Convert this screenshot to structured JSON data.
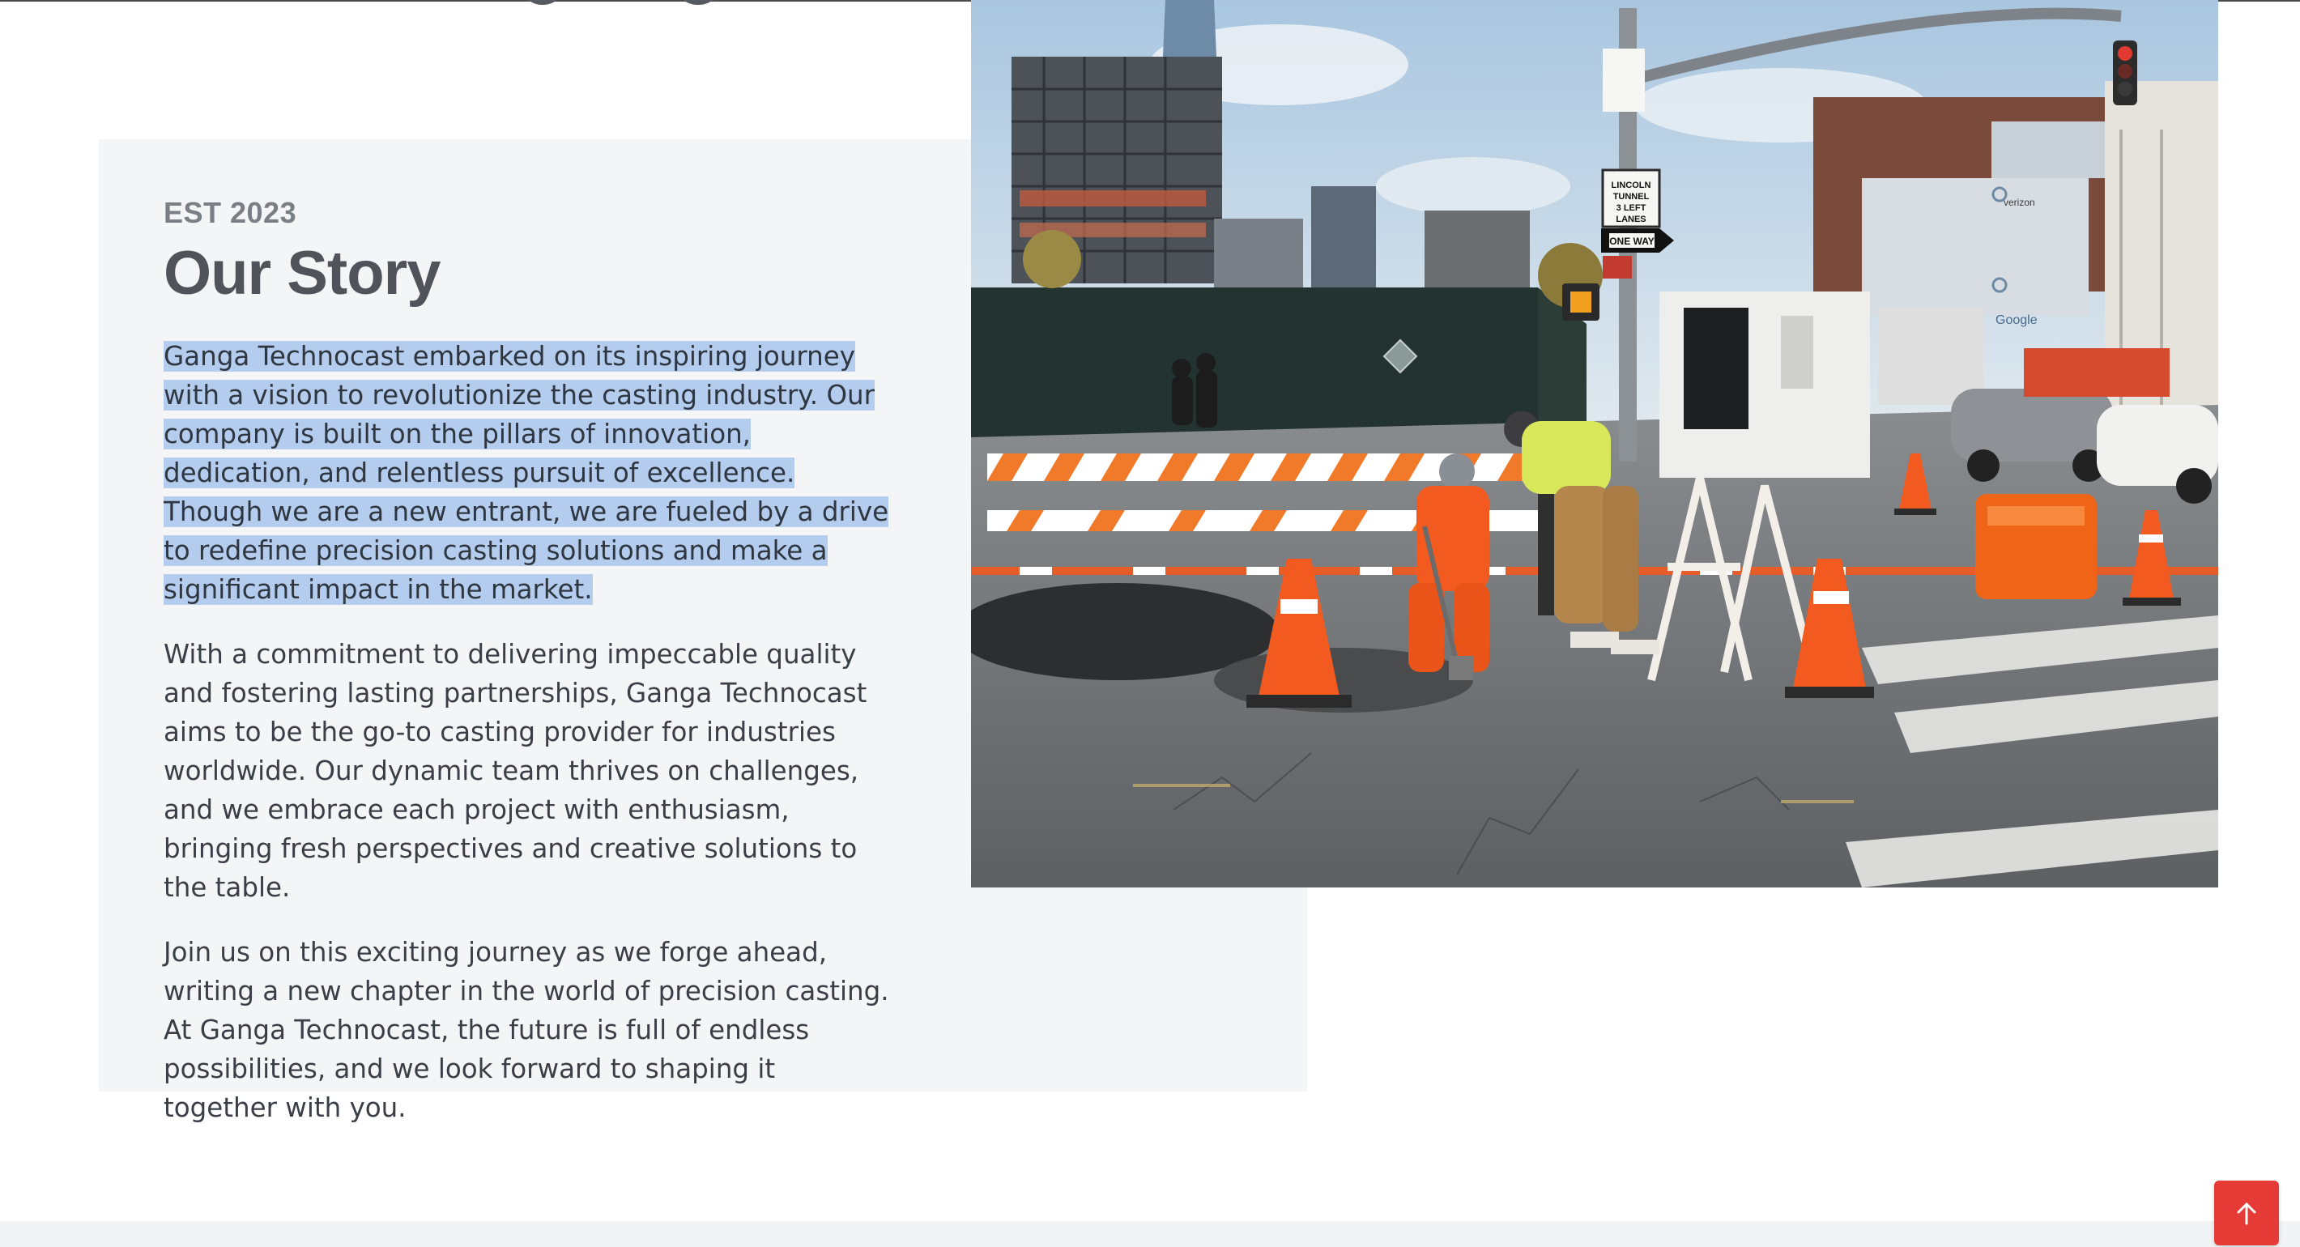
{
  "story": {
    "eyebrow": "EST 2023",
    "title": "Our Story",
    "paragraphs": [
      "Ganga Technocast embarked on its inspiring journey with a vision to revolutionize the casting industry. Our company is built on the pillars of innovation, dedication, and relentless pursuit of excellence. Though we are a new entrant, we are fueled by a drive to redefine precision casting solutions and make a significant impact in the market.",
      "With a commitment to delivering impeccable quality and fostering lasting partnerships, Ganga Technocast aims to be the go-to casting provider for industries worldwide. Our dynamic team thrives on challenges, and we embrace each project with enthusiasm, bringing fresh perspectives and creative solutions to the table.",
      "Join us on this exciting journey as we forge ahead, writing a new chapter in the world of precision casting. At Ganga Technocast, the future is full of endless possibilities, and we look forward to shaping it together with you."
    ]
  },
  "photo": {
    "signs": {
      "tunnel": "LINCOLN TUNNEL 3 LEFT LANES",
      "one_way": "ONE WAY",
      "billboard": "Google",
      "billboard_brand": "verizon"
    }
  },
  "back_to_top": {
    "icon": "arrow-up-icon"
  },
  "colors": {
    "card_bg": "#f4f5f7",
    "highlight": "#b4cdee",
    "accent": "#e53a36",
    "title": "#50545a",
    "eyebrow": "#7a7e85",
    "body_text": "#3a3f47"
  }
}
